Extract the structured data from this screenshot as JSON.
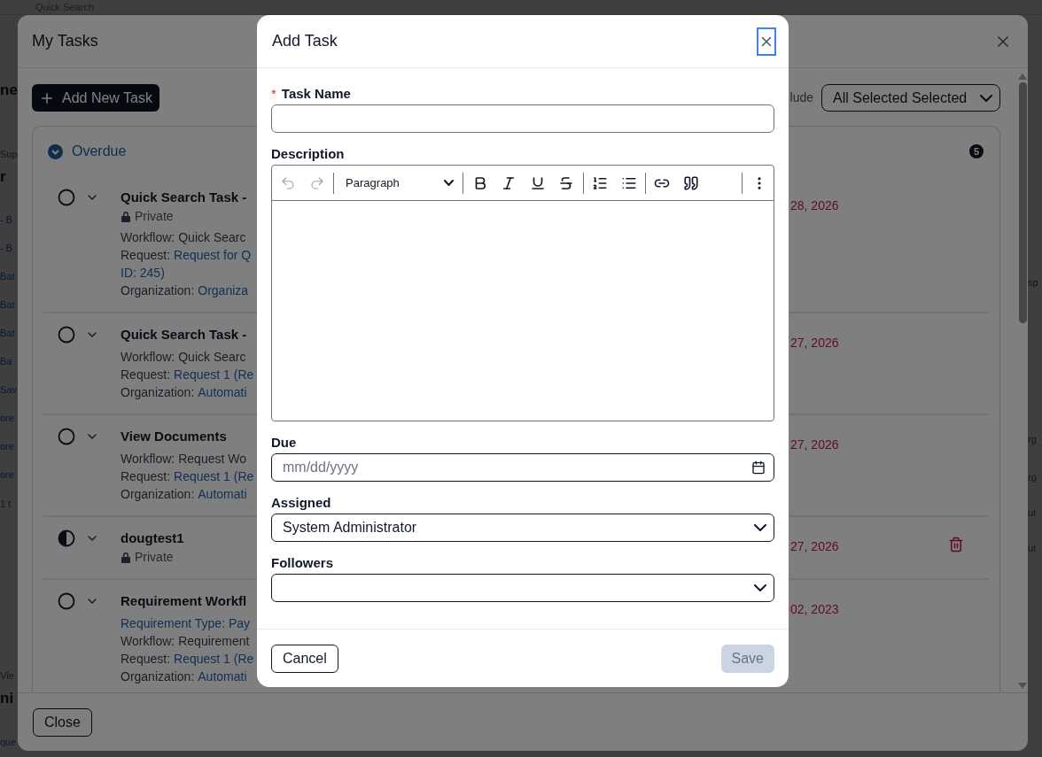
{
  "background_page": {
    "search_placeholder": "Quick Search",
    "left_fragments": [
      {
        "text": "ne",
        "kind": "heading"
      },
      {
        "text": "Sup",
        "kind": "caption"
      },
      {
        "text": "r",
        "kind": "heading"
      },
      {
        "text": "- B",
        "kind": "link"
      },
      {
        "text": "- B",
        "kind": "link"
      },
      {
        "text": "Bat",
        "kind": "link"
      },
      {
        "text": "Bat",
        "kind": "link"
      },
      {
        "text": "Bat",
        "kind": "link"
      },
      {
        "text": "Ba",
        "kind": "link"
      },
      {
        "text": "Sav",
        "kind": "link"
      },
      {
        "text": "ore",
        "kind": "link"
      },
      {
        "text": "ore",
        "kind": "link"
      },
      {
        "text": "ore",
        "kind": "link"
      },
      {
        "text": "1 t",
        "kind": "caption"
      },
      {
        "text": "Vie",
        "kind": "caption"
      },
      {
        "text": "ni",
        "kind": "heading"
      },
      {
        "text": "que",
        "kind": "link"
      }
    ],
    "right_fragments": [
      {
        "text": "sp",
        "kind": "caption"
      },
      {
        "text": "rg",
        "kind": "caption"
      },
      {
        "text": "rg",
        "kind": "link"
      },
      {
        "text": "ut",
        "kind": "link"
      },
      {
        "text": "ut",
        "kind": "link"
      }
    ]
  },
  "my_tasks": {
    "title": "My Tasks",
    "add_button": "Add New Task",
    "filter_label": "lude",
    "filter_value": "All Selected Selected",
    "group": {
      "title": "Overdue",
      "expanded": true,
      "count": "5",
      "tasks": [
        {
          "in_progress": false,
          "title": "Quick Search Task -",
          "visibility": "Private",
          "details": [
            {
              "label": "Workflow:",
              "value": "Quick Searc",
              "link": false
            },
            {
              "label": "Request:",
              "value": "Request for Q",
              "link": true
            },
            {
              "value": "ID: 245)",
              "link": true
            },
            {
              "label": "Organization:",
              "value": "Organiza",
              "link": true
            }
          ],
          "due": "28, 2026",
          "deletable": false
        },
        {
          "in_progress": false,
          "title": "Quick Search Task -",
          "details": [
            {
              "label": "Workflow:",
              "value": "Quick Searc",
              "link": false
            },
            {
              "label": "Request:",
              "value": "Request 1 (Re",
              "link": true
            },
            {
              "label": "Organization:",
              "value": "Automati",
              "link": true
            }
          ],
          "due": "27, 2026",
          "deletable": false
        },
        {
          "in_progress": false,
          "title": "View Documents",
          "details": [
            {
              "label": "Workflow:",
              "value": "Request Wo",
              "link": false
            },
            {
              "label": "Request:",
              "value": "Request 1 (Re",
              "link": true
            },
            {
              "label": "Organization:",
              "value": "Automati",
              "link": true
            }
          ],
          "due": "27, 2026",
          "deletable": false
        },
        {
          "in_progress": true,
          "title": "dougtest1",
          "visibility": "Private",
          "due": "27, 2026",
          "deletable": true
        },
        {
          "in_progress": false,
          "title": "Requirement Workfl",
          "details": [
            {
              "value": "Requirement Type: Pay",
              "link": true
            },
            {
              "label": "Workflow:",
              "value": "Requirement",
              "link": false
            },
            {
              "label": "Request:",
              "value": "Request 1 (Re",
              "link": true
            },
            {
              "label": "Organization:",
              "value": "Automati",
              "link": true
            }
          ],
          "due": "02, 2023",
          "deletable": false
        }
      ]
    },
    "close_button": "Close"
  },
  "add_task": {
    "title": "Add Task",
    "close_focused": true,
    "fields": [
      {
        "kind": "text",
        "label": "Task Name",
        "required_mark": "*"
      },
      {
        "kind": "editor",
        "label": "Description",
        "toolbar": {
          "undo_disabled": true,
          "redo_disabled": true,
          "block_style": "Paragraph"
        }
      },
      {
        "kind": "date",
        "label": "Due",
        "placeholder": "mm/dd/yyyy"
      },
      {
        "kind": "select",
        "label": "Assigned",
        "value": "System Administrator"
      },
      {
        "kind": "select",
        "label": "Followers"
      }
    ],
    "buttons": [
      {
        "label": "Cancel",
        "disabled": false
      },
      {
        "label": "Save",
        "disabled": true
      }
    ]
  }
}
